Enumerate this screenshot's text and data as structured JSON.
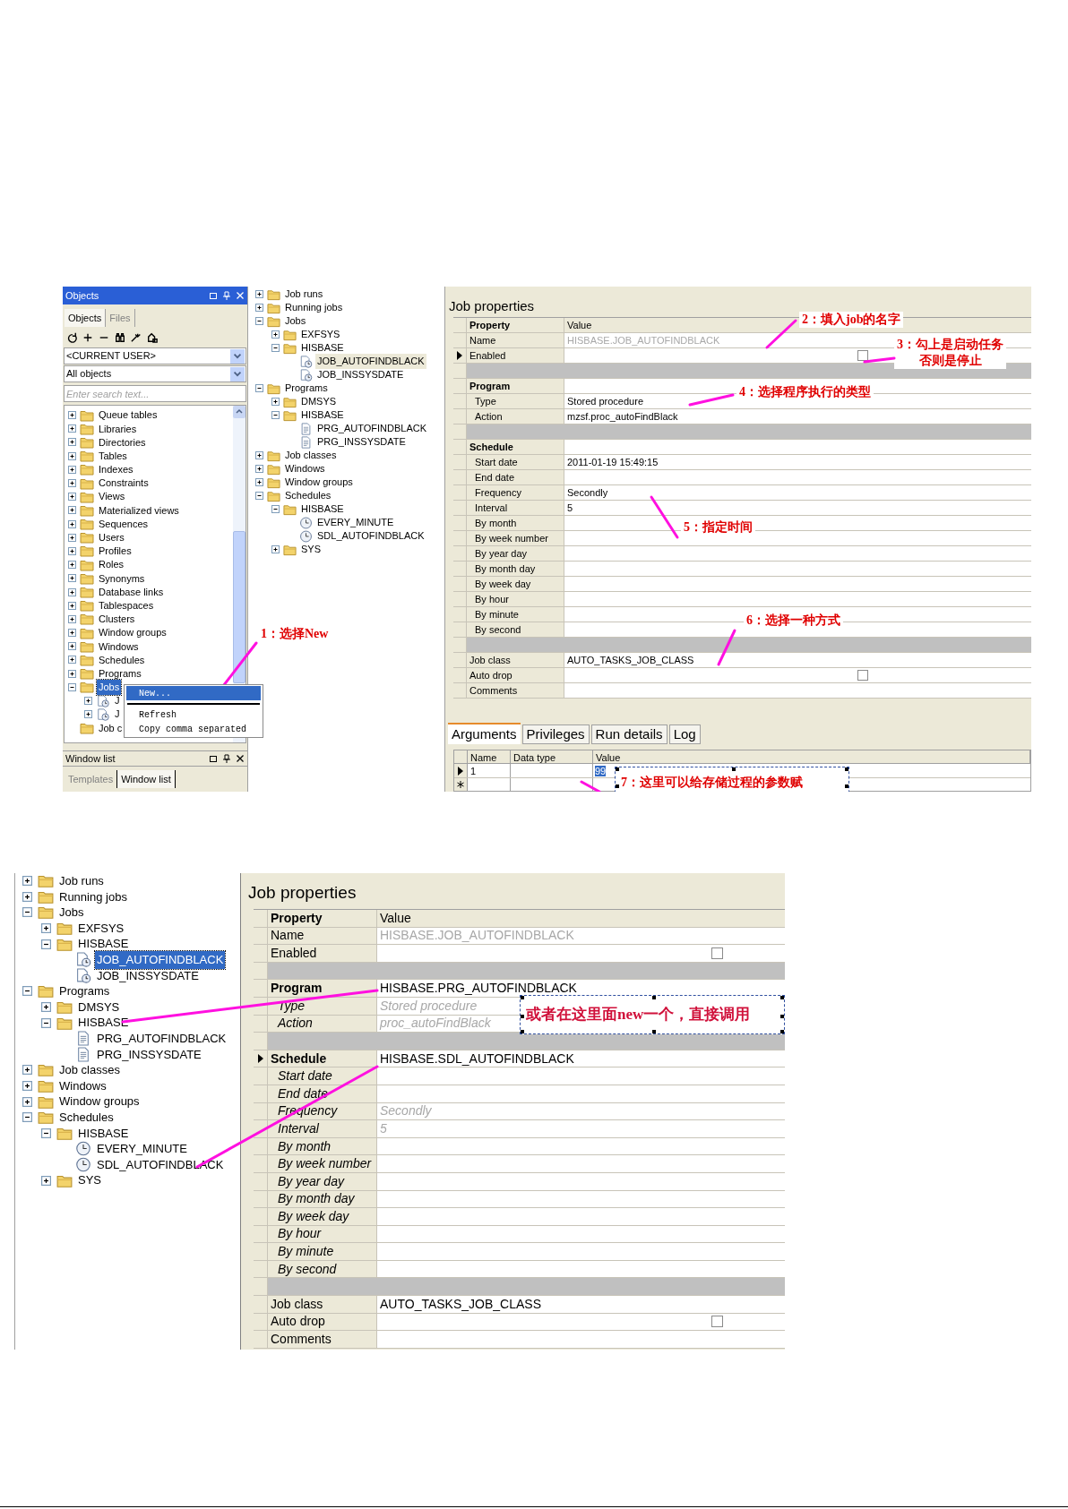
{
  "screenshot_1": {
    "objects_panel": {
      "title": "Objects",
      "tabs": [
        {
          "label": "Objects",
          "selected": true
        },
        {
          "label": "Files",
          "selected": false
        }
      ],
      "owner_dropdown": "<CURRENT USER>",
      "type_dropdown": "All objects",
      "search": {
        "placeholder": "Enter search text..."
      },
      "tree": {
        "focused": true,
        "items": [
          {
            "label": "Queue tables",
            "kind": "folder",
            "expanded": false,
            "selected": false
          },
          {
            "label": "Libraries",
            "kind": "folder",
            "expanded": false,
            "selected": false
          },
          {
            "label": "Directories",
            "kind": "folder",
            "expanded": false,
            "selected": false
          },
          {
            "label": "Tables",
            "kind": "folder",
            "expanded": false,
            "selected": false
          },
          {
            "label": "Indexes",
            "kind": "folder",
            "expanded": false,
            "selected": false
          },
          {
            "label": "Constraints",
            "kind": "folder",
            "expanded": false,
            "selected": false
          },
          {
            "label": "Views",
            "kind": "folder",
            "expanded": false,
            "selected": false
          },
          {
            "label": "Materialized views",
            "kind": "folder",
            "expanded": false,
            "selected": false
          },
          {
            "label": "Sequences",
            "kind": "folder",
            "expanded": false,
            "selected": false
          },
          {
            "label": "Users",
            "kind": "folder",
            "expanded": false,
            "selected": false
          },
          {
            "label": "Profiles",
            "kind": "folder",
            "expanded": false,
            "selected": false
          },
          {
            "label": "Roles",
            "kind": "folder",
            "expanded": false,
            "selected": false
          },
          {
            "label": "Synonyms",
            "kind": "folder",
            "expanded": false,
            "selected": false
          },
          {
            "label": "Database links",
            "kind": "folder",
            "expanded": false,
            "selected": false
          },
          {
            "label": "Tablespaces",
            "kind": "folder",
            "expanded": false,
            "selected": false
          },
          {
            "label": "Clusters",
            "kind": "folder",
            "expanded": false,
            "selected": false
          },
          {
            "label": "Window groups",
            "kind": "folder",
            "expanded": false,
            "selected": false
          },
          {
            "label": "Windows",
            "kind": "folder",
            "expanded": false,
            "selected": false
          },
          {
            "label": "Schedules",
            "kind": "folder",
            "expanded": false,
            "selected": false
          },
          {
            "label": "Programs",
            "kind": "folder",
            "expanded": false,
            "selected": false
          },
          {
            "label": "Jobs",
            "kind": "folder",
            "expanded": true,
            "selected": true,
            "children": [
              {
                "label": "J",
                "kind": "job",
                "expanded": false,
                "selected": false
              },
              {
                "label": "J",
                "kind": "job",
                "expanded": false,
                "selected": false
              }
            ]
          },
          {
            "label": "Job c",
            "kind": "folder",
            "selected": false
          }
        ]
      },
      "context_menu": [
        {
          "kind": "item",
          "label": "New...",
          "selected": true
        },
        {
          "kind": "separator"
        },
        {
          "kind": "item",
          "label": "Refresh",
          "selected": false
        },
        {
          "kind": "item",
          "label": "Copy comma separated",
          "selected": false
        }
      ],
      "window_list": {
        "title": "Window list",
        "tabs": [
          {
            "label": "Templates",
            "selected": false
          },
          {
            "label": "Window list",
            "selected": true
          }
        ]
      }
    },
    "scheduler_tree": {
      "focused": false,
      "items": [
        {
          "label": "Job runs",
          "kind": "folder",
          "expanded": false,
          "selected": false
        },
        {
          "label": "Running jobs",
          "kind": "folder",
          "expanded": false,
          "selected": false
        },
        {
          "label": "Jobs",
          "kind": "folder",
          "expanded": true,
          "selected": false,
          "children": [
            {
              "label": "EXFSYS",
              "kind": "folder",
              "expanded": false,
              "selected": false
            },
            {
              "label": "HISBASE",
              "kind": "folder",
              "expanded": true,
              "selected": false,
              "children": [
                {
                  "label": "JOB_AUTOFINDBLACK",
                  "kind": "job",
                  "selected": true
                },
                {
                  "label": "JOB_INSSYSDATE",
                  "kind": "job",
                  "selected": false
                }
              ]
            }
          ]
        },
        {
          "label": "Programs",
          "kind": "folder",
          "expanded": true,
          "selected": false,
          "children": [
            {
              "label": "DMSYS",
              "kind": "folder",
              "expanded": false,
              "selected": false
            },
            {
              "label": "HISBASE",
              "kind": "folder",
              "expanded": true,
              "selected": false,
              "children": [
                {
                  "label": "PRG_AUTOFINDBLACK",
                  "kind": "program",
                  "selected": false
                },
                {
                  "label": "PRG_INSSYSDATE",
                  "kind": "program",
                  "selected": false
                }
              ]
            }
          ]
        },
        {
          "label": "Job classes",
          "kind": "folder",
          "expanded": false,
          "selected": false
        },
        {
          "label": "Windows",
          "kind": "folder",
          "expanded": false,
          "selected": false
        },
        {
          "label": "Window groups",
          "kind": "folder",
          "expanded": false,
          "selected": false
        },
        {
          "label": "Schedules",
          "kind": "folder",
          "expanded": true,
          "selected": false,
          "children": [
            {
              "label": "HISBASE",
              "kind": "folder",
              "expanded": true,
              "selected": false,
              "children": [
                {
                  "label": "EVERY_MINUTE",
                  "kind": "schedule",
                  "selected": false
                },
                {
                  "label": "SDL_AUTOFINDBLACK",
                  "kind": "schedule",
                  "selected": false
                }
              ]
            },
            {
              "label": "SYS",
              "kind": "folder",
              "expanded": false,
              "selected": false
            }
          ]
        }
      ]
    },
    "job_properties": {
      "title": "Job properties",
      "rows": [
        {
          "kind": "header",
          "label": "Property",
          "value": "Value",
          "selected": false
        },
        {
          "kind": "text",
          "label": "Name",
          "value": "HISBASE.JOB_AUTOFINDBLACK",
          "disabled": true,
          "selected": false
        },
        {
          "kind": "checkbox",
          "label": "Enabled",
          "checked": false,
          "selected": true
        },
        {
          "kind": "spacer"
        },
        {
          "kind": "section",
          "label": "Program",
          "selected": false,
          "children": [
            {
              "kind": "text",
              "label": "Type",
              "value": "Stored procedure",
              "disabled": false,
              "selected": false
            },
            {
              "kind": "text",
              "label": "Action",
              "value": "mzsf.proc_autoFindBlack",
              "disabled": false,
              "selected": false
            }
          ]
        },
        {
          "kind": "spacer"
        },
        {
          "kind": "section",
          "label": "Schedule",
          "selected": false,
          "children": [
            {
              "kind": "text",
              "label": "Start date",
              "value": "2011-01-19 15:49:15",
              "disabled": false,
              "selected": false
            },
            {
              "kind": "text",
              "label": "End date",
              "disabled": false,
              "selected": false
            },
            {
              "kind": "text",
              "label": "Frequency",
              "value": "Secondly",
              "disabled": false,
              "selected": false
            },
            {
              "kind": "text",
              "label": "Interval",
              "value": "5",
              "disabled": false,
              "selected": false
            },
            {
              "kind": "text",
              "label": "By month",
              "disabled": false,
              "selected": false
            },
            {
              "kind": "text",
              "label": "By week number",
              "disabled": false,
              "selected": false
            },
            {
              "kind": "text",
              "label": "By year day",
              "disabled": false,
              "selected": false
            },
            {
              "kind": "text",
              "label": "By month day",
              "disabled": false,
              "selected": false
            },
            {
              "kind": "text",
              "label": "By week day",
              "disabled": false,
              "selected": false
            },
            {
              "kind": "text",
              "label": "By hour",
              "disabled": false,
              "selected": false
            },
            {
              "kind": "text",
              "label": "By minute",
              "disabled": false,
              "selected": false
            },
            {
              "kind": "text",
              "label": "By second",
              "disabled": false,
              "selected": false
            }
          ]
        },
        {
          "kind": "spacer"
        },
        {
          "kind": "text",
          "label": "Job class",
          "value": "AUTO_TASKS_JOB_CLASS",
          "disabled": false,
          "selected": false
        },
        {
          "kind": "checkbox",
          "label": "Auto drop",
          "checked": false,
          "selected": false
        },
        {
          "kind": "text",
          "label": "Comments",
          "selected": false
        }
      ]
    },
    "detail_tabs": [
      {
        "label": "Arguments",
        "selected": true
      },
      {
        "label": "Privileges",
        "selected": false
      },
      {
        "label": "Run details",
        "selected": false
      },
      {
        "label": "Log",
        "selected": false
      }
    ],
    "arguments": {
      "columns": [
        "Name",
        "Data type",
        "Value"
      ],
      "rows": [
        {
          "name": "1",
          "value": "99",
          "selected": true
        }
      ]
    },
    "annotations": [
      {
        "kind": "label",
        "text": "1：选择New"
      },
      {
        "kind": "label",
        "text": "2：填入job的名字"
      },
      {
        "kind": "label",
        "lines": [
          "3：勾上是启动任务",
          "否则是停止"
        ]
      },
      {
        "kind": "label",
        "text": "4：选择程序执行的类型"
      },
      {
        "kind": "label",
        "text": "5：指定时间"
      },
      {
        "kind": "label",
        "text": "6：选择一种方式"
      },
      {
        "kind": "box",
        "text": "7：这里可以给存储过程的参数赋"
      }
    ]
  },
  "screenshot_2": {
    "scheduler_tree": {
      "focused": true,
      "items": [
        {
          "label": "Job runs",
          "kind": "folder",
          "expanded": false,
          "selected": false
        },
        {
          "label": "Running jobs",
          "kind": "folder",
          "expanded": false,
          "selected": false
        },
        {
          "label": "Jobs",
          "kind": "folder",
          "expanded": true,
          "selected": false,
          "children": [
            {
              "label": "EXFSYS",
              "kind": "folder",
              "expanded": false,
              "selected": false
            },
            {
              "label": "HISBASE",
              "kind": "folder",
              "expanded": true,
              "selected": false,
              "children": [
                {
                  "label": "JOB_AUTOFINDBLACK",
                  "kind": "job",
                  "selected": true
                },
                {
                  "label": "JOB_INSSYSDATE",
                  "kind": "job",
                  "selected": false
                }
              ]
            }
          ]
        },
        {
          "label": "Programs",
          "kind": "folder",
          "expanded": true,
          "selected": false,
          "children": [
            {
              "label": "DMSYS",
              "kind": "folder",
              "expanded": false,
              "selected": false
            },
            {
              "label": "HISBASE",
              "kind": "folder",
              "expanded": true,
              "selected": false,
              "children": [
                {
                  "label": "PRG_AUTOFINDBLACK",
                  "kind": "program",
                  "selected": false
                },
                {
                  "label": "PRG_INSSYSDATE",
                  "kind": "program",
                  "selected": false
                }
              ]
            }
          ]
        },
        {
          "label": "Job classes",
          "kind": "folder",
          "expanded": false,
          "selected": false
        },
        {
          "label": "Windows",
          "kind": "folder",
          "expanded": false,
          "selected": false
        },
        {
          "label": "Window groups",
          "kind": "folder",
          "expanded": false,
          "selected": false
        },
        {
          "label": "Schedules",
          "kind": "folder",
          "expanded": true,
          "selected": false,
          "children": [
            {
              "label": "HISBASE",
              "kind": "folder",
              "expanded": true,
              "selected": false,
              "children": [
                {
                  "label": "EVERY_MINUTE",
                  "kind": "schedule",
                  "selected": false
                },
                {
                  "label": "SDL_AUTOFINDBLACK",
                  "kind": "schedule",
                  "selected": false
                }
              ]
            },
            {
              "label": "SYS",
              "kind": "folder",
              "expanded": false,
              "selected": false
            }
          ]
        }
      ]
    },
    "job_properties": {
      "title": "Job properties",
      "rows": [
        {
          "kind": "header",
          "label": "Property",
          "value": "Value",
          "selected": false
        },
        {
          "kind": "text",
          "label": "Name",
          "value": "HISBASE.JOB_AUTOFINDBLACK",
          "disabled": true,
          "selected": false
        },
        {
          "kind": "checkbox",
          "label": "Enabled",
          "checked": false,
          "selected": false
        },
        {
          "kind": "spacer"
        },
        {
          "kind": "section",
          "label": "Program",
          "value": "HISBASE.PRG_AUTOFINDBLACK",
          "selected": false,
          "children": [
            {
              "kind": "text",
              "label": "Type",
              "value": "Stored procedure",
              "disabled": true,
              "selected": false
            },
            {
              "kind": "text",
              "label": "Action",
              "value": "proc_autoFindBlack",
              "disabled": true,
              "selected": false
            }
          ]
        },
        {
          "kind": "spacer"
        },
        {
          "kind": "section",
          "label": "Schedule",
          "value": "HISBASE.SDL_AUTOFINDBLACK",
          "selected": true,
          "children": [
            {
              "kind": "text",
              "label": "Start date",
              "disabled": true,
              "selected": false
            },
            {
              "kind": "text",
              "label": "End date",
              "disabled": true,
              "selected": false
            },
            {
              "kind": "text",
              "label": "Frequency",
              "value": "Secondly",
              "disabled": true,
              "selected": false
            },
            {
              "kind": "text",
              "label": "Interval",
              "value": "5",
              "disabled": true,
              "selected": false
            },
            {
              "kind": "text",
              "label": "By month",
              "disabled": true,
              "selected": false
            },
            {
              "kind": "text",
              "label": "By week number",
              "disabled": true,
              "selected": false
            },
            {
              "kind": "text",
              "label": "By year day",
              "disabled": true,
              "selected": false
            },
            {
              "kind": "text",
              "label": "By month day",
              "disabled": true,
              "selected": false
            },
            {
              "kind": "text",
              "label": "By week day",
              "disabled": true,
              "selected": false
            },
            {
              "kind": "text",
              "label": "By hour",
              "disabled": true,
              "selected": false
            },
            {
              "kind": "text",
              "label": "By minute",
              "disabled": true,
              "selected": false
            },
            {
              "kind": "text",
              "label": "By second",
              "disabled": true,
              "selected": false
            }
          ]
        },
        {
          "kind": "spacer"
        },
        {
          "kind": "text",
          "label": "Job class",
          "value": "AUTO_TASKS_JOB_CLASS",
          "disabled": false,
          "selected": false
        },
        {
          "kind": "checkbox",
          "label": "Auto drop",
          "checked": false,
          "selected": false
        },
        {
          "kind": "text",
          "label": "Comments",
          "selected": false
        }
      ]
    },
    "annotations": [
      {
        "kind": "box",
        "text": "或者在这里面new一个，直接调用"
      }
    ]
  }
}
